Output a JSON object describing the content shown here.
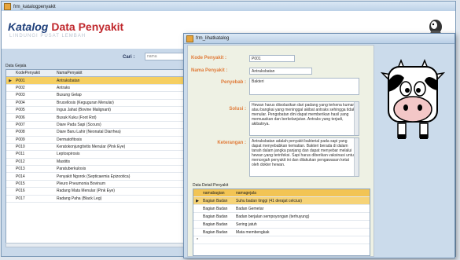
{
  "back_window": {
    "title": "frm_katalogpenyakit",
    "brand_a": "Katalog",
    "brand_b": "Data Penyakit",
    "brand_sub": "LINDUNGI PUSAT LEMBAH",
    "search_label": "Cari :",
    "search_value": "nama",
    "grid_label": "Data Gejala",
    "columns": [
      "KodePenyakit",
      "NamaPenyakit"
    ],
    "rows": [
      [
        "P001",
        "Antraksbatan"
      ],
      [
        "P002",
        "Antraks"
      ],
      [
        "P003",
        "Busung Gelap"
      ],
      [
        "P004",
        "Brucellosis (Keguguran Menular)"
      ],
      [
        "P005",
        "Ingus Jahat (Bovine Malignant)"
      ],
      [
        "P006",
        "Busuk Kuku (Foot Rot)"
      ],
      [
        "P007",
        "Diare Pada Sapi (Scours)"
      ],
      [
        "P008",
        "Diare Baru Lahir (Neonatal Diarrhea)"
      ],
      [
        "P009",
        "Dermatofitosis"
      ],
      [
        "P010",
        "Keratokonjungtivitis Menular (Pink Eye)"
      ],
      [
        "P011",
        "Leptospirosis"
      ],
      [
        "P012",
        "Mastitis"
      ],
      [
        "P013",
        "Paratuberkulosis"
      ],
      [
        "P014",
        "Penyakit Ngorok (Septicaemia Epizootica)"
      ],
      [
        "P015",
        "Pleuro Pneumonia Bovinum"
      ],
      [
        "P016",
        "Radang Mata Menular (Pink Eye)"
      ],
      [
        "P017",
        "Radang Paha (Black Leg)"
      ]
    ]
  },
  "front_window": {
    "title": "frm_lihatkatalog",
    "labels": {
      "kode": "Kode Penyakit :",
      "nama": "Nama Penyakit :",
      "penyebab": "Penyebab :",
      "solusi": "Solusi :",
      "keterangan": "Keterangan :"
    },
    "values": {
      "kode": "P001",
      "nama": "Antraksbatan",
      "penyebab": "Bakteri",
      "solusi": "Hewan harus diisolasikan dari padang yang terkena kuman atau bangkai yang meninggal akibat antraks sehingga tidak menular. Pengobatan dini dapat memberikan hasil yang memuaskan dan berkelanjutan. Antraks yang terjadi, akibatnya.",
      "keterangan": "Antraksbatan adalah penyakit bakterial pada sapi yang dapat menyebabkan kematian. Bakteri berada di dalam tanah dalam jangka panjang dan dapat menyebar melalui hewan yang terinfeksi. Sapi harus diberikan vaksinasi untuk mencegah penyakit ini dan dilakukan pengawasan ketat oleh dokter hewan."
    },
    "grid_label": "Data Detail Penyakit",
    "columns": [
      "namabagian",
      "namagejala"
    ],
    "rows": [
      [
        "Bagian Badan",
        "Suhu badan tinggi (41 derajat celcius)"
      ],
      [
        "Bagian Badan",
        "Badan Gemetar"
      ],
      [
        "Bagian Badan",
        "Badan berjalan sempoyongan (terhuyung)"
      ],
      [
        "Bagian Badan",
        "Sering jatuh"
      ],
      [
        "Bagian Badan",
        "Mata membengkak"
      ]
    ]
  }
}
